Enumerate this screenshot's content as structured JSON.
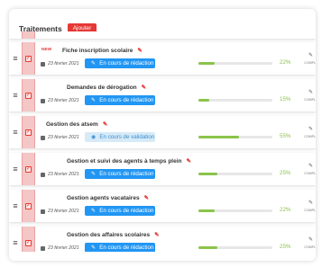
{
  "header": {
    "title": "Traitements",
    "add_label": "Ajouter"
  },
  "colors": {
    "accent_red": "#e53935",
    "status_blue": "#2196f3",
    "progress_green": "#8bc34a"
  },
  "icons": {
    "drag": "drag-handle-icon",
    "checkbox": "checkbox-icon",
    "edit": "pencil-icon",
    "calendar": "calendar-icon"
  },
  "rows": [
    {
      "name": "Fiche inscription scolaire",
      "badge": "NEW",
      "date": "23 février 2021",
      "status": "En cours de rédaction",
      "status_kind": "redaction",
      "progress": 22,
      "progress_label": "22%",
      "edit_label": "COMPL"
    },
    {
      "name": "Demandes de dérogation",
      "date": "23 février 2021",
      "status": "En cours de rédaction",
      "status_kind": "redaction",
      "progress": 15,
      "progress_label": "15%",
      "edit_label": "COMPL"
    },
    {
      "name": "Gestion des atsem",
      "date": "23 février 2021",
      "status": "En cours de validation",
      "status_kind": "validation",
      "progress": 55,
      "progress_label": "55%",
      "edit_label": "COMPL"
    },
    {
      "name": "Gestion et suivi des agents à temps plein",
      "date": "23 février 2021",
      "status": "En cours de rédaction",
      "status_kind": "redaction",
      "progress": 25,
      "progress_label": "25%",
      "edit_label": "COMPL"
    },
    {
      "name": "Gestion agents vacataires",
      "date": "23 février 2021",
      "status": "En cours de rédaction",
      "status_kind": "redaction",
      "progress": 22,
      "progress_label": "22%",
      "edit_label": "COMPL"
    },
    {
      "name": "Gestion des affaires scolaires",
      "date": "23 février 2021",
      "status": "En cours de rédaction",
      "status_kind": "redaction",
      "progress": 25,
      "progress_label": "25%",
      "edit_label": "COMPL"
    }
  ]
}
